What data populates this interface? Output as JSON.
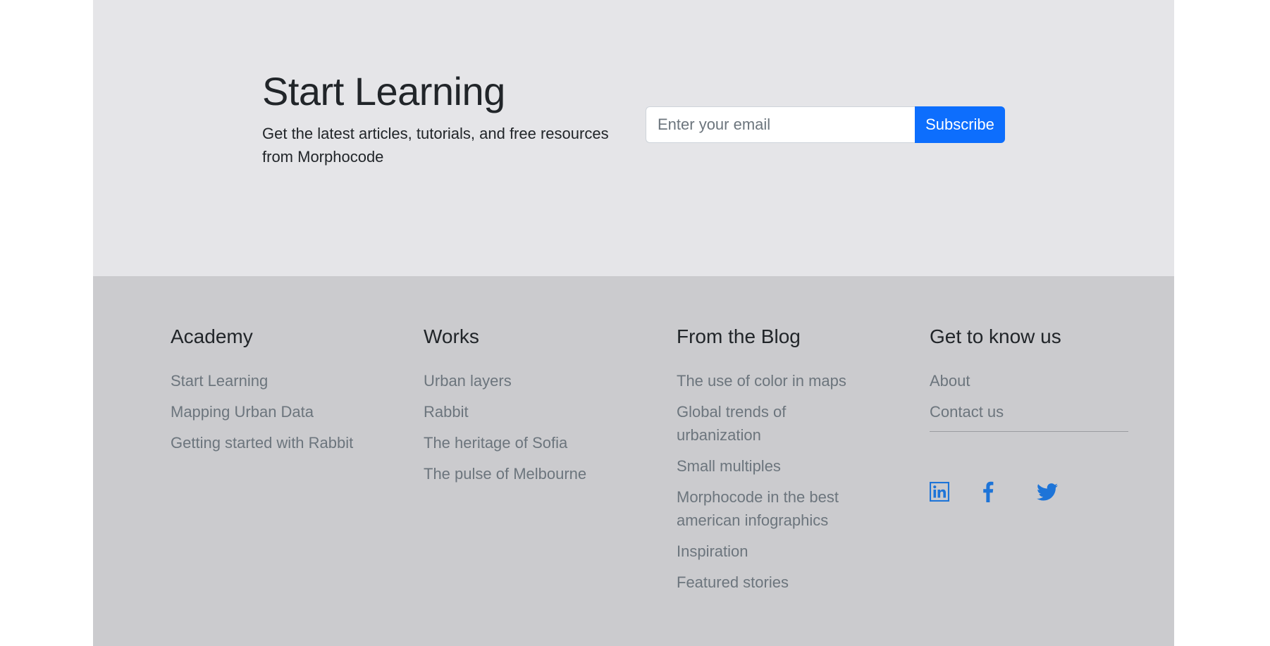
{
  "newsletter": {
    "title": "Start Learning",
    "subtitle": "Get the latest articles, tutorials, and free resources from Morphocode",
    "email_placeholder": "Enter your email",
    "subscribe_label": "Subscribe"
  },
  "footer": {
    "columns": [
      {
        "heading": "Academy",
        "links": [
          "Start Learning",
          "Mapping Urban Data",
          "Getting started with Rabbit"
        ]
      },
      {
        "heading": "Works",
        "links": [
          "Urban layers",
          "Rabbit",
          "The heritage of Sofia",
          "The pulse of Melbourne"
        ]
      },
      {
        "heading": "From the Blog",
        "links": [
          "The use of color in maps",
          "Global trends of urbanization",
          "Small multiples",
          "Morphocode in the best american infographics",
          "Inspiration",
          "Featured stories"
        ]
      },
      {
        "heading": "Get to know us",
        "links": [
          "About",
          "Contact us"
        ]
      }
    ],
    "social_icons": [
      "linkedin-icon",
      "facebook-icon",
      "twitter-icon"
    ]
  },
  "colors": {
    "newsletter_bg": "#e5e5e8",
    "footer_bg": "#cbcbce",
    "primary": "#0d6efd",
    "link": "#6c757d",
    "heading": "#212529",
    "social": "#1d74d8"
  }
}
